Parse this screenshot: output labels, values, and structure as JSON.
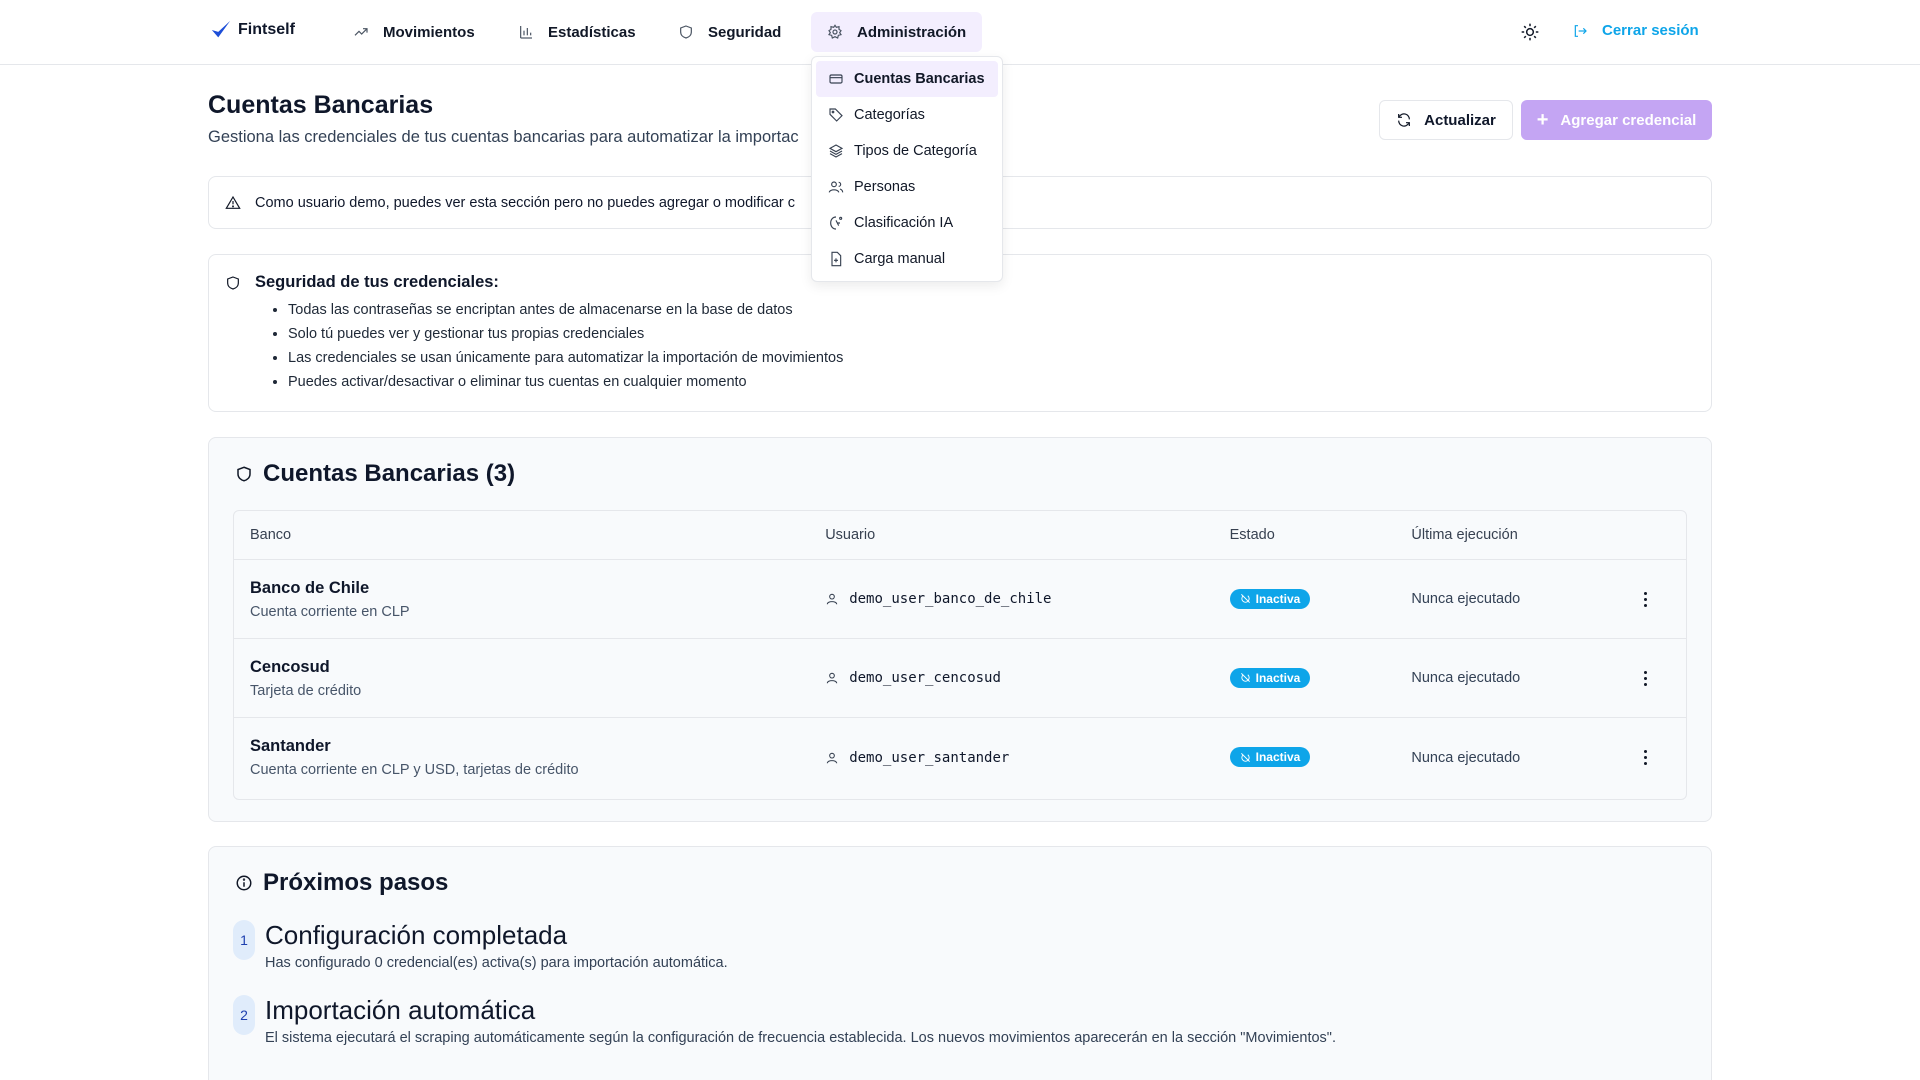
{
  "nav": {
    "brand": "Fintself",
    "items": [
      {
        "label": "Movimientos",
        "icon": "trending-up-icon"
      },
      {
        "label": "Estadísticas",
        "icon": "bar-chart-icon"
      },
      {
        "label": "Seguridad",
        "icon": "shield-icon"
      },
      {
        "label": "Administración",
        "icon": "gear-icon"
      }
    ],
    "logout": "Cerrar sesión"
  },
  "dropdown": {
    "items": [
      {
        "label": "Cuentas Bancarias",
        "icon": "credit-card-icon"
      },
      {
        "label": "Categorías",
        "icon": "tag-icon"
      },
      {
        "label": "Tipos de Categoría",
        "icon": "layers-icon"
      },
      {
        "label": "Personas",
        "icon": "users-icon"
      },
      {
        "label": "Clasificación IA",
        "icon": "ai-icon"
      },
      {
        "label": "Carga manual",
        "icon": "file-plus-icon"
      }
    ]
  },
  "header": {
    "title": "Cuentas Bancarias",
    "subtitle": "Gestiona las credenciales de tus cuentas bancarias para automatizar la importac",
    "refresh": "Actualizar",
    "add": "Agregar credencial"
  },
  "alert": {
    "text": "Como usuario demo, puedes ver esta sección pero no puedes agregar o modificar c"
  },
  "security": {
    "title": "Seguridad de tus credenciales:",
    "items": [
      "Todas las contraseñas se encriptan antes de almacenarse en la base de datos",
      "Solo tú puedes ver y gestionar tus propias credenciales",
      "Las credenciales se usan únicamente para automatizar la importación de movimientos",
      "Puedes activar/desactivar o eliminar tus cuentas en cualquier momento"
    ]
  },
  "accounts": {
    "title": "Cuentas Bancarias (3)",
    "columns": [
      "Banco",
      "Usuario",
      "Estado",
      "Última ejecución"
    ],
    "rows": [
      {
        "bank": "Banco de Chile",
        "desc": "Cuenta corriente en CLP",
        "user": "demo_user_banco_de_chile",
        "status": "Inactiva",
        "last": "Nunca ejecutado"
      },
      {
        "bank": "Cencosud",
        "desc": "Tarjeta de crédito",
        "user": "demo_user_cencosud",
        "status": "Inactiva",
        "last": "Nunca ejecutado"
      },
      {
        "bank": "Santander",
        "desc": "Cuenta corriente en CLP y USD, tarjetas de crédito",
        "user": "demo_user_santander",
        "status": "Inactiva",
        "last": "Nunca ejecutado"
      }
    ]
  },
  "next": {
    "title": "Próximos pasos",
    "steps": [
      {
        "num": "1",
        "title": "Configuración completada",
        "text": "Has configurado 0 credencial(es) activa(s) para importación automática."
      },
      {
        "num": "2",
        "title": "Importación automática",
        "text": "El sistema ejecutará el scraping automáticamente según la configuración de frecuencia establecida. Los nuevos movimientos aparecerán en la sección \"Movimientos\"."
      }
    ]
  },
  "colors": {
    "accent": "#0ea5e9",
    "primary_disabled": "#c4a5f3",
    "active_bg": "#f3eefe"
  }
}
